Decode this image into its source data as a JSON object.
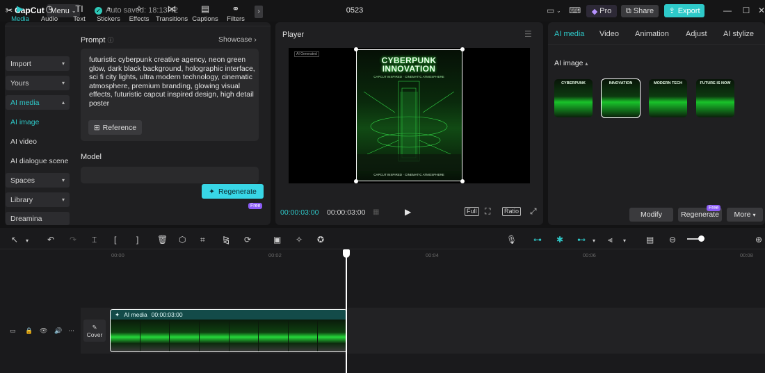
{
  "titlebar": {
    "logo_text": "CapCut",
    "menu_label": "Menu",
    "autosave": "Auto saved: 18:13:42",
    "project_name": "0523",
    "pro_label": "Pro",
    "share_label": "Share",
    "export_label": "Export"
  },
  "toolbar_tabs": [
    {
      "label": "Media"
    },
    {
      "label": "Audio"
    },
    {
      "label": "Text"
    },
    {
      "label": "Stickers"
    },
    {
      "label": "Effects"
    },
    {
      "label": "Transitions"
    },
    {
      "label": "Captions"
    },
    {
      "label": "Filters"
    }
  ],
  "sidebar": {
    "items": [
      {
        "label": "Import"
      },
      {
        "label": "Yours"
      },
      {
        "label": "AI media"
      },
      {
        "label": "AI image"
      },
      {
        "label": "AI video"
      },
      {
        "label": "AI dialogue scene"
      },
      {
        "label": "Spaces"
      },
      {
        "label": "Library"
      },
      {
        "label": "Dreamina"
      }
    ]
  },
  "ai_image_form": {
    "prompt_label": "Prompt",
    "showcase_label": "Showcase",
    "prompt_text": "futuristic cyberpunk creative agency, neon green glow, dark black background, holographic interface, sci fi city lights, ultra modern technology, cinematic atmosphere, premium branding, glowing visual effects, futuristic capcut inspired design, high detail poster",
    "reference_label": "Reference",
    "model_label": "Model",
    "regenerate_label": "Regenerate",
    "free_badge": "Free"
  },
  "player": {
    "title": "Player",
    "poster_title": "CYBERPUNK INNOVATION",
    "poster_subtitle": "CAPCUT INSPIRED · CINEMATIC ATMOSPHERE",
    "poster_footer": "CAPCUT INSPIRED · CINEMATIC ATMOSPHERE",
    "corner_tag": "AI Generated",
    "time_current": "00:00:03:00",
    "time_total": "00:00:03:00",
    "full_label": "Full",
    "ratio_label": "Ratio"
  },
  "right_panel": {
    "tabs": [
      {
        "label": "AI media"
      },
      {
        "label": "Video"
      },
      {
        "label": "Animation"
      },
      {
        "label": "Adjust"
      },
      {
        "label": "AI stylize"
      }
    ],
    "section_label": "AI image",
    "thumbnails": [
      {
        "caption": "CYBERPUNK"
      },
      {
        "caption": "INNOVATION"
      },
      {
        "caption": "MODERN TECH"
      },
      {
        "caption": "FUTURE IS NOW"
      }
    ],
    "modify_label": "Modify",
    "regenerate_label": "Regenerate",
    "free_badge": "Free",
    "more_label": "More"
  },
  "timeline": {
    "ticks": [
      "00:00",
      "00:02",
      "00:04",
      "00:06",
      "00:08"
    ],
    "cover_label": "Cover",
    "clip_label": "AI media",
    "clip_duration": "00:00:03:00"
  }
}
